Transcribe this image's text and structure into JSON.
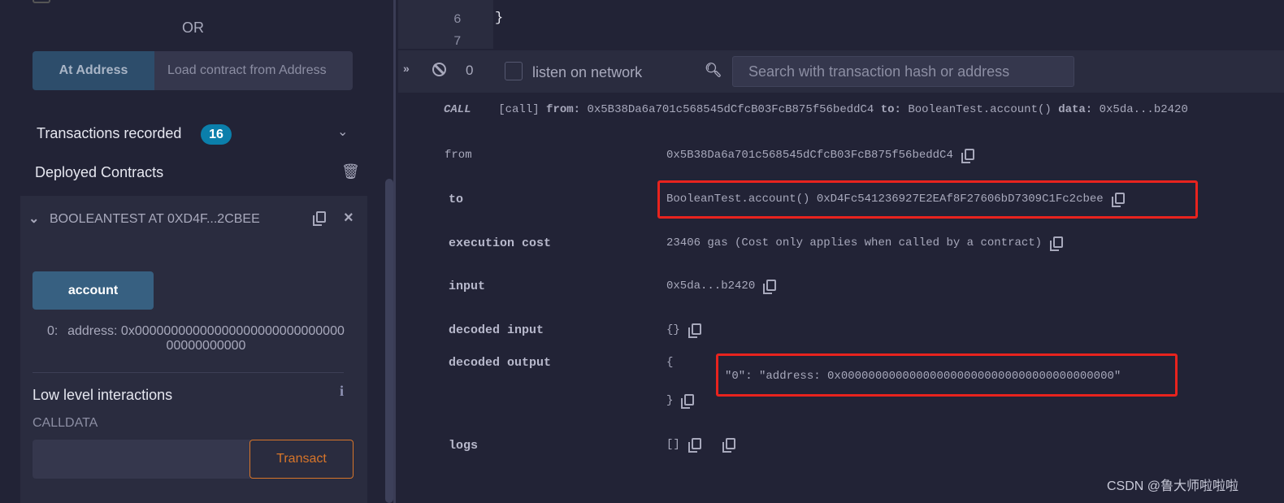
{
  "left": {
    "or": "OR",
    "at_address": "At Address",
    "load_placeholder": "Load contract from Address",
    "transactions_recorded": "Transactions recorded",
    "tx_count": "16",
    "deployed_contracts": "Deployed Contracts",
    "contract_title": "BOOLEANTEST AT 0XD4F...2CBEE",
    "function_button": "account",
    "result_index": "0:",
    "result_value": "address: 0x0000000000000000000000000000000000000000",
    "low_level": "Low level interactions",
    "calldata": "CALLDATA",
    "transact": "Transact"
  },
  "editor": {
    "lines": [
      "6",
      "7"
    ],
    "code_line6": "}"
  },
  "terminal": {
    "count": "0",
    "listen": "listen on network",
    "search_placeholder": "Search with transaction hash or address",
    "call_tag": "CALL",
    "call_summary": "[call]",
    "from_k": "from:",
    "from_v": "0x5B38Da6a701c568545dCfcB03FcB875f56beddC4",
    "to_k": "to:",
    "to_v": "BooleanTest.account()",
    "data_k": "data:",
    "data_v": "0x5da...b2420",
    "rows": {
      "from": {
        "label": "from",
        "value": "0x5B38Da6a701c568545dCfcB03FcB875f56beddC4"
      },
      "to": {
        "label": "to",
        "value": "BooleanTest.account() 0xD4Fc541236927E2EAf8F27606bD7309C1Fc2cbee"
      },
      "cost": {
        "label": "execution cost",
        "value": "23406 gas (Cost only applies when called by a contract)"
      },
      "input": {
        "label": "input",
        "value": "0x5da...b2420"
      },
      "decoded_input": {
        "label": "decoded input",
        "value": "{}"
      },
      "decoded_output": {
        "label": "decoded output",
        "open": "{",
        "line": "\"0\": \"address: 0x0000000000000000000000000000000000000000\"",
        "close": "}"
      },
      "logs": {
        "label": "logs",
        "value": "[]"
      }
    }
  },
  "watermark": "CSDN @鲁大师啦啦啦",
  "colors": {
    "accent": "#2d4d6b",
    "badge": "#0b7fab",
    "highlight": "#e8231e",
    "transact": "#d7752a"
  }
}
